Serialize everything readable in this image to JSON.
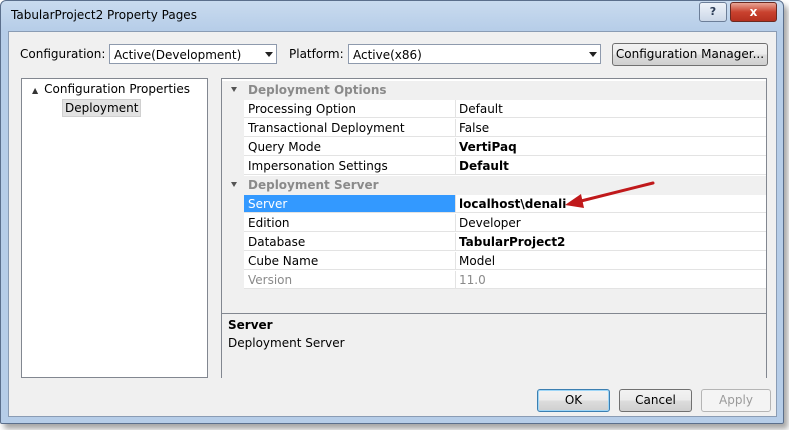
{
  "window": {
    "title": "TabularProject2 Property Pages",
    "help_glyph": "?",
    "close_glyph": "x"
  },
  "toolbar": {
    "configuration_label": "Configuration:",
    "configuration_value": "Active(Development)",
    "platform_label": "Platform:",
    "platform_value": "Active(x86)",
    "config_manager_label": "Configuration Manager..."
  },
  "tree": {
    "root": "Configuration Properties",
    "child": "Deployment",
    "expander_glyph": "▲"
  },
  "grid": {
    "categories": [
      {
        "name": "Deployment Options",
        "rows": [
          {
            "name": "Processing Option",
            "value": "Default",
            "bold": false
          },
          {
            "name": "Transactional Deployment",
            "value": "False",
            "bold": false
          },
          {
            "name": "Query Mode",
            "value": "VertiPaq",
            "bold": true
          },
          {
            "name": "Impersonation Settings",
            "value": "Default",
            "bold": true
          }
        ]
      },
      {
        "name": "Deployment Server",
        "rows": [
          {
            "name": "Server",
            "value": "localhost\\denali",
            "bold": true,
            "selected": true
          },
          {
            "name": "Edition",
            "value": "Developer",
            "bold": false
          },
          {
            "name": "Database",
            "value": "TabularProject2",
            "bold": true
          },
          {
            "name": "Cube Name",
            "value": "Model",
            "bold": false
          },
          {
            "name": "Version",
            "value": "11.0",
            "bold": false,
            "readonly": true
          }
        ]
      }
    ],
    "description": {
      "title": "Server",
      "text": "Deployment Server"
    }
  },
  "buttons": {
    "ok": "OK",
    "cancel": "Cancel",
    "apply": "Apply"
  },
  "colors": {
    "selection": "#3399ff",
    "annotation_arrow": "#c0191b"
  }
}
